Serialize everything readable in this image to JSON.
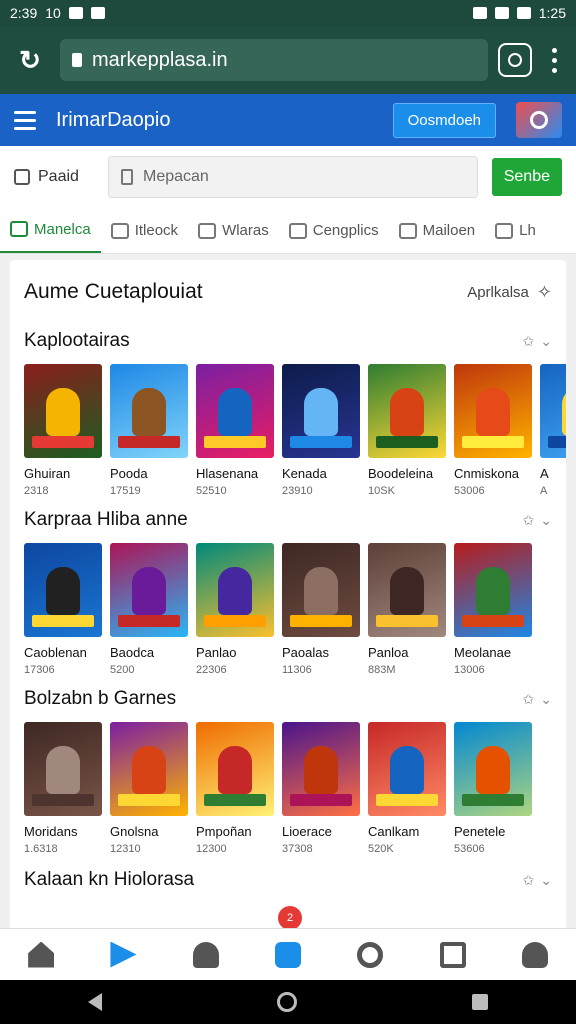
{
  "status": {
    "time": "2:39",
    "left_extra": "10",
    "right_time": "1:25"
  },
  "browser": {
    "url": "markepplasa.in"
  },
  "appbar": {
    "title": "IrimarDaopio",
    "connect_label": "Oosmdoeh"
  },
  "search": {
    "paid_label": "Paaid",
    "placeholder": "Mepacan",
    "send_label": "Senbe"
  },
  "tabs": [
    {
      "label": "Manelca",
      "icon": "home-icon",
      "active": true
    },
    {
      "label": "Itleock",
      "icon": "heart-icon",
      "active": false
    },
    {
      "label": "Wlaras",
      "icon": "clock-icon",
      "active": false
    },
    {
      "label": "Cengplics",
      "icon": "checkbox-icon",
      "active": false
    },
    {
      "label": "Mailoen",
      "icon": "pen-icon",
      "active": false
    },
    {
      "label": "Lh",
      "icon": "chat-icon",
      "active": false
    }
  ],
  "card": {
    "title": "Aume Cuetaplouiat",
    "action": "Aprlkalsa"
  },
  "sections": [
    {
      "title": "Kaplootairas",
      "games": [
        {
          "name": "Ghuiran",
          "size": "2318",
          "c1": "#8b1e1e",
          "c2": "#1b5e20",
          "fig": "#f4b400",
          "ban": "#e53935"
        },
        {
          "name": "Pooda",
          "size": "17519",
          "c1": "#1e88e5",
          "c2": "#81d4fa",
          "fig": "#8d5524",
          "ban": "#c62828"
        },
        {
          "name": "Hlasenana",
          "size": "52510",
          "c1": "#7b1fa2",
          "c2": "#e91e63",
          "fig": "#1565c0",
          "ban": "#ffca28"
        },
        {
          "name": "Kenada",
          "size": "23910",
          "c1": "#0d1b4a",
          "c2": "#283593",
          "fig": "#64b5f6",
          "ban": "#1e88e5"
        },
        {
          "name": "Boodeleina",
          "size": "10SK",
          "c1": "#2e7d32",
          "c2": "#fdd835",
          "fig": "#d84315",
          "ban": "#1b5e20"
        },
        {
          "name": "Cnmiskona",
          "size": "53006",
          "c1": "#bf360c",
          "c2": "#ffb300",
          "fig": "#e64a19",
          "ban": "#ffeb3b"
        },
        {
          "name": "A",
          "size": "A",
          "c1": "#1565c0",
          "c2": "#42a5f5",
          "fig": "#fdd835",
          "ban": "#0d47a1"
        }
      ]
    },
    {
      "title": "Karpraa Hliba anne",
      "games": [
        {
          "name": "Caoblenan",
          "size": "17306",
          "c1": "#0d47a1",
          "c2": "#1976d2",
          "fig": "#212121",
          "ban": "#fdd835"
        },
        {
          "name": "Baodca",
          "size": "5200",
          "c1": "#ad1457",
          "c2": "#29b6f6",
          "fig": "#6a1b9a",
          "ban": "#c62828"
        },
        {
          "name": "Panlao",
          "size": "22306",
          "c1": "#00897b",
          "c2": "#fbc02d",
          "fig": "#4527a0",
          "ban": "#ffa000"
        },
        {
          "name": "Paoalas",
          "size": "11306",
          "c1": "#3e2723",
          "c2": "#6d4c41",
          "fig": "#8d6e63",
          "ban": "#ffb300"
        },
        {
          "name": "Panloa",
          "size": "883M",
          "c1": "#5d4037",
          "c2": "#a1887f",
          "fig": "#3e2723",
          "ban": "#fbc02d"
        },
        {
          "name": "Meolanae",
          "size": "13006",
          "c1": "#b71c1c",
          "c2": "#1e88e5",
          "fig": "#2e7d32",
          "ban": "#d84315"
        }
      ]
    },
    {
      "title": "Bolzabn b Garnes",
      "games": [
        {
          "name": "Moridans",
          "size": "1.6318",
          "c1": "#3e2723",
          "c2": "#795548",
          "fig": "#a1887f",
          "ban": "#4e342e"
        },
        {
          "name": "Gnolsna",
          "size": "12310",
          "c1": "#7b1fa2",
          "c2": "#ffb300",
          "fig": "#d84315",
          "ban": "#fdd835"
        },
        {
          "name": "Pmpoñan",
          "size": "12300",
          "c1": "#ef6c00",
          "c2": "#fff176",
          "fig": "#c62828",
          "ban": "#2e7d32"
        },
        {
          "name": "Lioerace",
          "size": "37308",
          "c1": "#4a148c",
          "c2": "#ff7043",
          "fig": "#bf360c",
          "ban": "#ad1457"
        },
        {
          "name": "Canlkam",
          "size": "520K",
          "c1": "#c62828",
          "c2": "#ff8a65",
          "fig": "#1565c0",
          "ban": "#fdd835"
        },
        {
          "name": "Penetele",
          "size": "53606",
          "c1": "#0288d1",
          "c2": "#aed581",
          "fig": "#e65100",
          "ban": "#2e7d32"
        }
      ]
    }
  ],
  "last_section_title": "Kalaan kn Hiolorasa",
  "badge": "2",
  "colors": {
    "appbar": "#1a62c6",
    "browser": "#1f4d40",
    "accent_green": "#1fa637"
  }
}
